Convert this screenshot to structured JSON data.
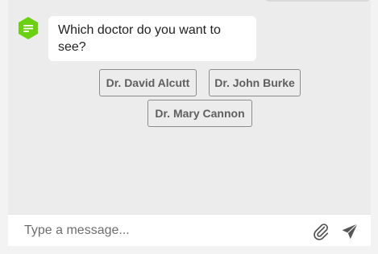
{
  "chat": {
    "bot_message": "Which doctor do you want to see?",
    "options": [
      {
        "label": "Dr. David Alcutt"
      },
      {
        "label": "Dr. John Burke"
      },
      {
        "label": "Dr. Mary Cannon"
      }
    ]
  },
  "composer": {
    "placeholder": "Type a message..."
  },
  "icons": {
    "avatar": "chat-bubble-icon",
    "attach": "paperclip-icon",
    "send": "send-icon"
  },
  "colors": {
    "accent": "#6ad00f",
    "chat_background": "#ececec",
    "bubble_background": "#ffffff",
    "button_border": "#8c8c8c",
    "button_text": "#5f5f5f"
  }
}
